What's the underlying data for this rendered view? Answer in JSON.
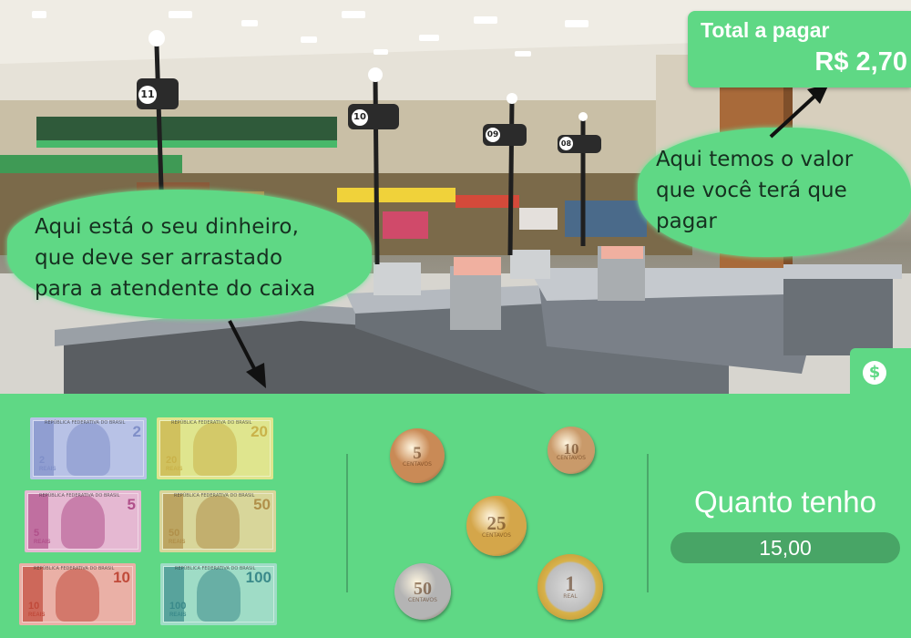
{
  "speech": {
    "left": "Aqui está o seu dinheiro,\nque deve ser arrastado\npara a atendente do caixa",
    "right": "Aqui temos o valor\nque você terá que\npagar"
  },
  "total": {
    "label": "Total a pagar",
    "value": "R$ 2,70"
  },
  "money_tab": {
    "icon": "dollar-circle-icon",
    "glyph": "$"
  },
  "lane_numbers": [
    "11",
    "10",
    "09",
    "08"
  ],
  "notes": [
    {
      "value": "2",
      "header": "REPÚBLICA FEDERATIVA DO BRASIL",
      "reais": "REAIS",
      "color": "#7f8fc8",
      "bg": "#b8c2e6"
    },
    {
      "value": "20",
      "header": "REPÚBLICA FEDERATIVA DO BRASIL",
      "reais": "REAIS",
      "color": "#c9b24a",
      "bg": "#dfe58e"
    },
    {
      "value": "5",
      "header": "REPÚBLICA FEDERATIVA DO BRASIL",
      "reais": "REAIS",
      "color": "#b0508a",
      "bg": "#e5b8d2"
    },
    {
      "value": "50",
      "header": "REPÚBLICA FEDERATIVA DO BRASIL",
      "reais": "REAIS",
      "color": "#b0904a",
      "bg": "#d8d69a"
    },
    {
      "value": "10",
      "header": "REPÚBLICA FEDERATIVA DO BRASIL",
      "reais": "REAIS",
      "color": "#c04a3a",
      "bg": "#eab0a6"
    },
    {
      "value": "100",
      "header": "REPÚBLICA FEDERATIVA DO BRASIL",
      "reais": "REAIS",
      "color": "#3a8a8a",
      "bg": "#9fdcc6"
    }
  ],
  "coins": [
    {
      "value": "5",
      "label": "CENTAVOS",
      "color": "#c98a56"
    },
    {
      "value": "10",
      "label": "CENTAVOS",
      "color": "#c99a6a"
    },
    {
      "value": "25",
      "label": "CENTAVOS",
      "color": "#d4a64a"
    },
    {
      "value": "50",
      "label": "CENTAVOS",
      "color": "#b4b4b4"
    },
    {
      "value": "1",
      "label": "REAL",
      "color": "#c8c8c8"
    }
  ],
  "wallet": {
    "title": "Quanto tenho",
    "value": "15,00"
  },
  "colors": {
    "panel": "#5fd885",
    "pill": "#48a566"
  }
}
